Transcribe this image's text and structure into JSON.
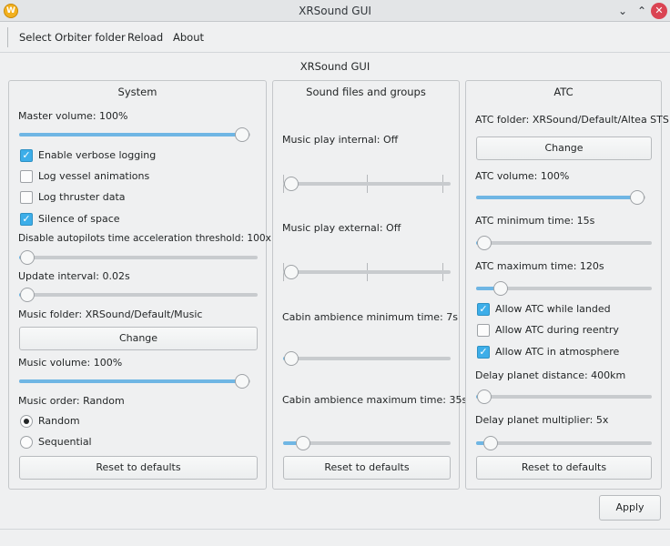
{
  "window": {
    "title": "XRSound GUI",
    "icon_letter": "W"
  },
  "menu": {
    "items": [
      "Select Orbiter folder",
      "Reload",
      "About"
    ]
  },
  "main_title": "XRSound GUI",
  "system": {
    "title": "System",
    "master_volume_label": "Master volume: 100%",
    "master_volume_value": 1.0,
    "verbose_logging": "Enable verbose logging",
    "log_vessel_animations": "Log vessel animations",
    "log_thruster_data": "Log thruster data",
    "silence_of_space": "Silence of space",
    "autopilot_label": "Disable autopilots time acceleration threshold: 100x",
    "autopilot_value": 0.0,
    "update_interval_label": "Update interval: 0.02s",
    "update_interval_value": 0.0,
    "music_folder_label": "Music folder: XRSound/Default/Music",
    "change_label": "Change",
    "music_volume_label": "Music volume: 100%",
    "music_volume_value": 1.0,
    "music_order_label": "Music order: Random",
    "random_label": "Random",
    "sequential_label": "Sequential",
    "reset_label": "Reset to defaults"
  },
  "sound": {
    "title": "Sound files and groups",
    "music_internal_label": "Music play internal: Off",
    "music_internal_value": 0.0,
    "music_external_label": "Music play external: Off",
    "music_external_value": 0.0,
    "cabin_min_label": "Cabin ambience minimum time: 7s",
    "cabin_min_value": 0.0,
    "cabin_max_label": "Cabin ambience maximum time: 35s",
    "cabin_max_value": 0.08,
    "reset_label": "Reset to defaults"
  },
  "atc": {
    "title": "ATC",
    "folder_label": "ATC folder: XRSound/Default/Altea STS",
    "change_label": "Change",
    "volume_label": "ATC volume: 100%",
    "volume_value": 1.0,
    "min_time_label": "ATC minimum time: 15s",
    "min_time_value": 0.0,
    "max_time_label": "ATC maximum time: 120s",
    "max_time_value": 0.1,
    "allow_landed": "Allow ATC while landed",
    "allow_reentry": "Allow ATC during reentry",
    "allow_atmosphere": "Allow ATC in atmosphere",
    "delay_distance_label": "Delay planet distance: 400km",
    "delay_distance_value": 0.0,
    "delay_multiplier_label": "Delay planet multiplier: 5x",
    "delay_multiplier_value": 0.04,
    "reset_label": "Reset to defaults"
  },
  "apply_label": "Apply",
  "colors": {
    "accent": "#3daee9",
    "slider_fill": "#6fb6e4",
    "close": "#da4453"
  }
}
